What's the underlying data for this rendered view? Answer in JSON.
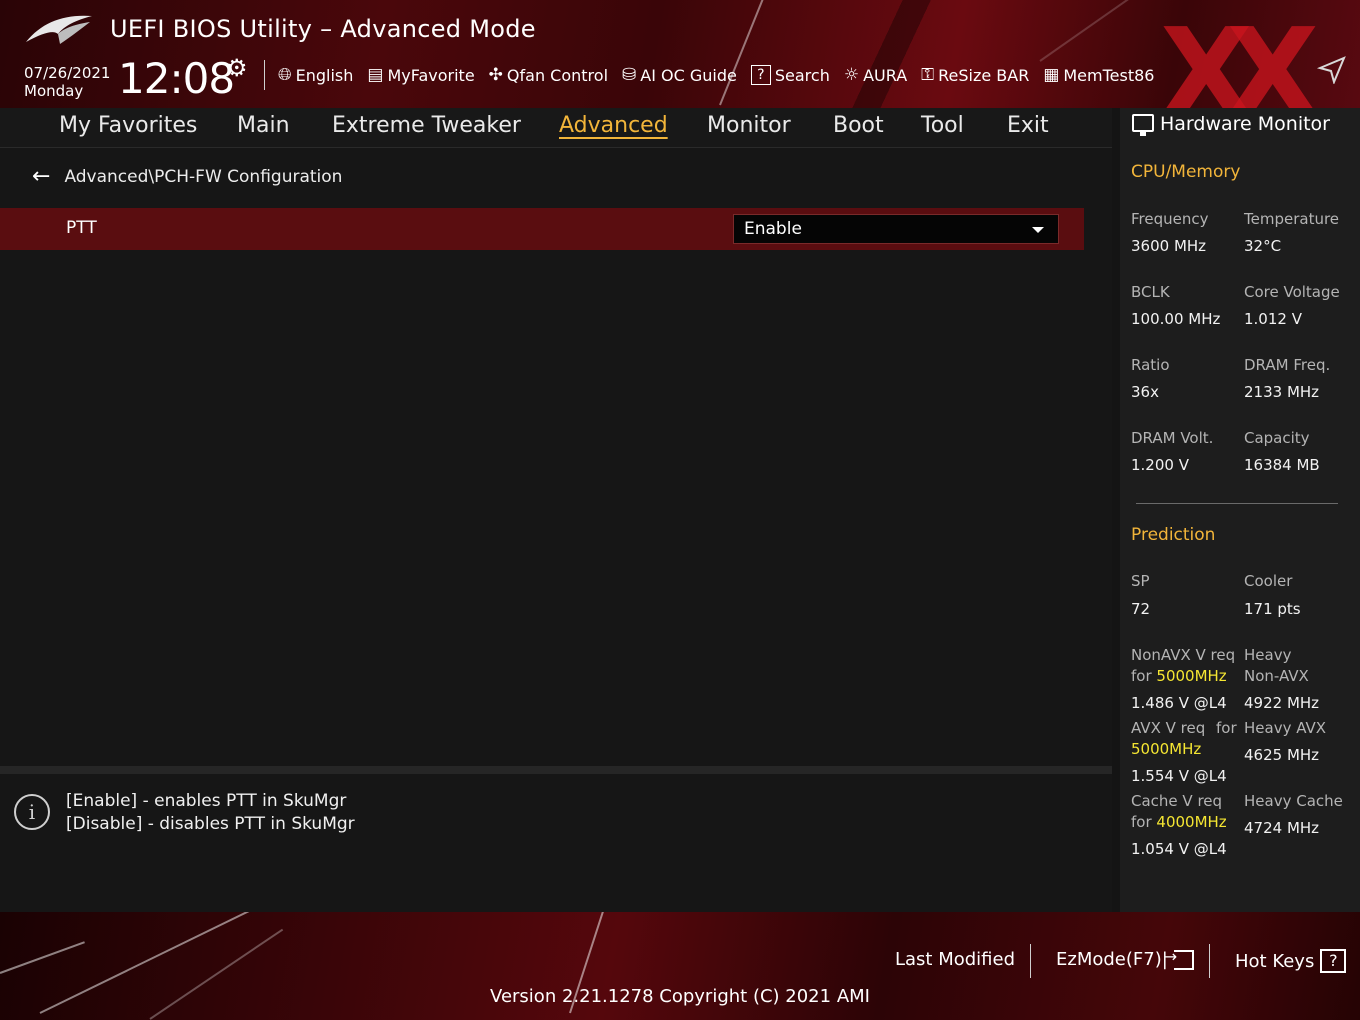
{
  "header": {
    "title": "UEFI BIOS Utility – Advanced Mode",
    "date": "07/26/2021",
    "day": "Monday",
    "time": "12:08",
    "toolbar": [
      {
        "label": "English",
        "icon": "globe-icon"
      },
      {
        "label": "MyFavorite",
        "icon": "favorite-icon"
      },
      {
        "label": "Qfan Control",
        "icon": "fan-icon"
      },
      {
        "label": "AI OC Guide",
        "icon": "ai-oc-icon"
      },
      {
        "label": "Search",
        "icon": "search-icon"
      },
      {
        "label": "AURA",
        "icon": "aura-icon"
      },
      {
        "label": "ReSize BAR",
        "icon": "resize-bar-icon"
      },
      {
        "label": "MemTest86",
        "icon": "memtest-icon"
      }
    ]
  },
  "nav": {
    "tabs": [
      "My Favorites",
      "Main",
      "Extreme Tweaker",
      "Advanced",
      "Monitor",
      "Boot",
      "Tool",
      "Exit"
    ],
    "active": "Advanced"
  },
  "breadcrumb": "Advanced\\PCH-FW Configuration",
  "setting": {
    "label": "PTT",
    "value": "Enable"
  },
  "help": {
    "line1": "[Enable] - enables PTT in SkuMgr",
    "line2": "[Disable] - disables PTT in SkuMgr"
  },
  "hardware_monitor": {
    "title": "Hardware Monitor",
    "cpu_memory": {
      "title": "CPU/Memory",
      "frequency_label": "Frequency",
      "frequency": "3600 MHz",
      "temperature_label": "Temperature",
      "temperature": "32°C",
      "bclk_label": "BCLK",
      "bclk": "100.00 MHz",
      "core_voltage_label": "Core Voltage",
      "core_voltage": "1.012 V",
      "ratio_label": "Ratio",
      "ratio": "36x",
      "dram_freq_label": "DRAM Freq.",
      "dram_freq": "2133 MHz",
      "dram_volt_label": "DRAM Volt.",
      "dram_volt": "1.200 V",
      "capacity_label": "Capacity",
      "capacity": "16384 MB"
    },
    "prediction": {
      "title": "Prediction",
      "sp_label": "SP",
      "sp": "72",
      "cooler_label": "Cooler",
      "cooler": "171 pts",
      "nonavx_label_a": "NonAVX V req",
      "nonavx_label_b": "for",
      "nonavx_freq": "5000MHz",
      "nonavx_value": "1.486 V @L4",
      "heavy_nonavx_label_a": "Heavy",
      "heavy_nonavx_label_b": "Non-AVX",
      "heavy_nonavx_value": "4922 MHz",
      "avx_label_a": "AVX V req",
      "avx_label_b": "for",
      "avx_freq": "5000MHz",
      "avx_value": "1.554 V @L4",
      "heavy_avx_label": "Heavy AVX",
      "heavy_avx_value": "4625 MHz",
      "cache_label_a": "Cache V req",
      "cache_label_b": "for",
      "cache_freq": "4000MHz",
      "cache_value": "1.054 V @L4",
      "heavy_cache_label": "Heavy Cache",
      "heavy_cache_value": "4724 MHz"
    }
  },
  "footer": {
    "last_modified": "Last Modified",
    "ezmode": "EzMode(F7)|",
    "hot_keys": "Hot Keys",
    "version": "Version 2.21.1278 Copyright (C) 2021 AMI"
  },
  "colors": {
    "accent": "#f2b53a",
    "highlight": "#f5e632",
    "selected_row": "#5a0d10",
    "brand_red": "#c8141e"
  }
}
